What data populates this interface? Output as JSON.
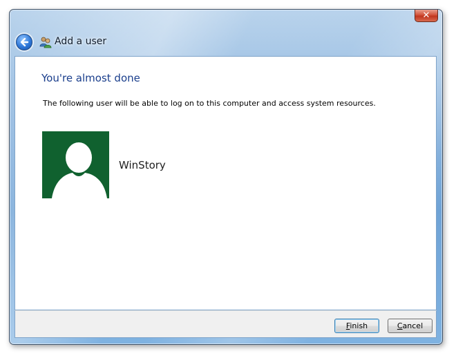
{
  "window": {
    "title": "Add a user",
    "close_label": "✕"
  },
  "content": {
    "heading": "You're almost done",
    "description": "The following user will be able to log on to this computer and access system resources.",
    "user_name": "WinStory"
  },
  "footer": {
    "finish_label": "Finish",
    "cancel_label": "Cancel"
  },
  "icons": {
    "back": "back-arrow-icon",
    "title": "users-icon",
    "avatar": "user-silhouette-icon"
  },
  "colors": {
    "heading": "#1a3e8c",
    "avatar_bg": "#10612f"
  }
}
